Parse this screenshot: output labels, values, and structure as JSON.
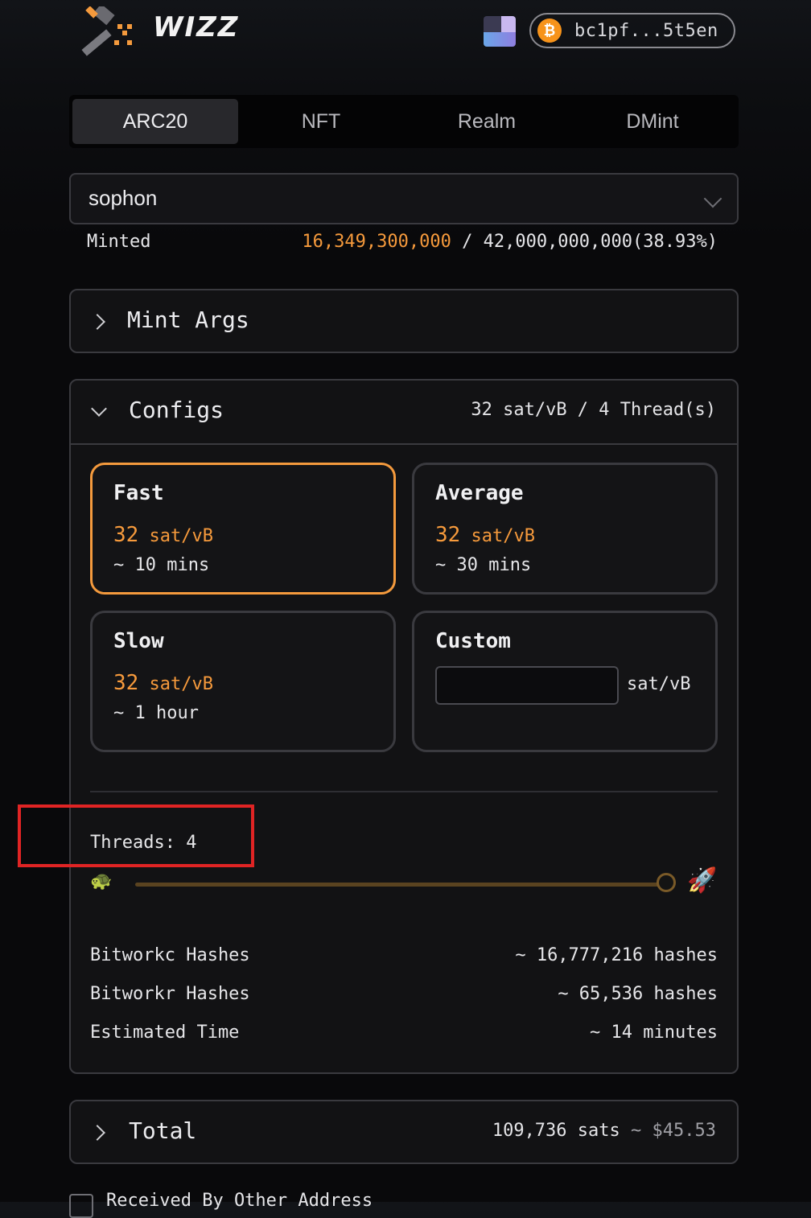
{
  "header": {
    "brand": "WIZZ",
    "logo_icon": "hammer-logo-icon",
    "wallet": {
      "address": "bc1pf...5t5en",
      "coin_icon": "bitcoin-icon",
      "coin_glyph": "₿"
    }
  },
  "tabs": [
    {
      "label": "ARC20",
      "active": true
    },
    {
      "label": "NFT",
      "active": false
    },
    {
      "label": "Realm",
      "active": false
    },
    {
      "label": "DMint",
      "active": false
    }
  ],
  "token_select": {
    "value": "sophon"
  },
  "minted": {
    "label": "Minted",
    "current": "16,349,300,000",
    "separator": " / ",
    "total": "42,000,000,000(38.93%)"
  },
  "mint_args": {
    "title": "Mint Args",
    "expanded": false
  },
  "configs": {
    "title": "Configs",
    "summary": "32 sat/vB / 4 Thread(s)",
    "expanded": true,
    "fee_options": [
      {
        "name": "Fast",
        "rate": "32",
        "unit": " sat/vB",
        "time": "~ 10 mins",
        "selected": true
      },
      {
        "name": "Average",
        "rate": "32",
        "unit": " sat/vB",
        "time": "~ 30 mins",
        "selected": false
      },
      {
        "name": "Slow",
        "rate": "32",
        "unit": " sat/vB",
        "time": "~ 1 hour",
        "selected": false
      }
    ],
    "custom": {
      "name": "Custom",
      "value": "",
      "unit": "sat/vB"
    },
    "threads": {
      "label": "Threads: 4",
      "value": 4,
      "min_icon": "turtle-icon",
      "max_icon": "rocket-icon",
      "level": 1.0
    },
    "stats": [
      {
        "label": "Bitworkc Hashes",
        "value": "~ 16,777,216 hashes"
      },
      {
        "label": "Bitworkr Hashes",
        "value": "~ 65,536 hashes"
      },
      {
        "label": "Estimated Time",
        "value": "~ 14 minutes"
      }
    ]
  },
  "total": {
    "title": "Total",
    "sats": "109,736 sats",
    "price": " ~ $45.53"
  },
  "bottom": {
    "label": "Received By Other Address"
  },
  "colors": {
    "accent": "#f69a3c",
    "highlight": "#e02424",
    "bitcoin": "#f7931a"
  }
}
